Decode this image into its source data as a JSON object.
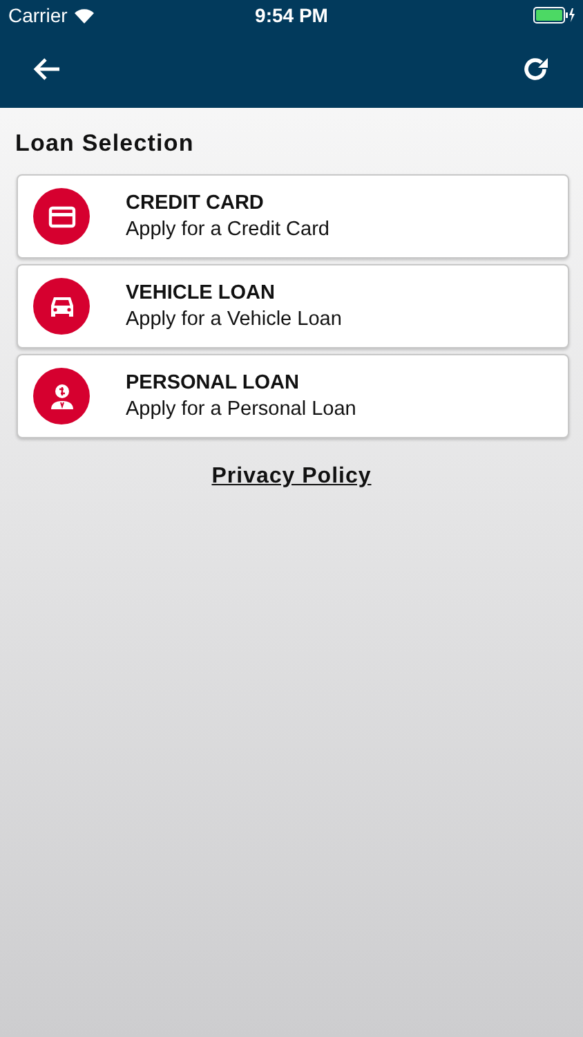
{
  "status_bar": {
    "carrier": "Carrier",
    "time": "9:54 PM"
  },
  "title": "Loan Selection",
  "options": [
    {
      "kind": "card",
      "title": "CREDIT CARD",
      "subtitle": "Apply for a Credit Card"
    },
    {
      "kind": "vehicle",
      "title": "VEHICLE LOAN",
      "subtitle": "Apply for a Vehicle Loan"
    },
    {
      "kind": "personal",
      "title": "PERSONAL LOAN",
      "subtitle": "Apply for a Personal Loan"
    }
  ],
  "privacy_link": "Privacy Policy"
}
